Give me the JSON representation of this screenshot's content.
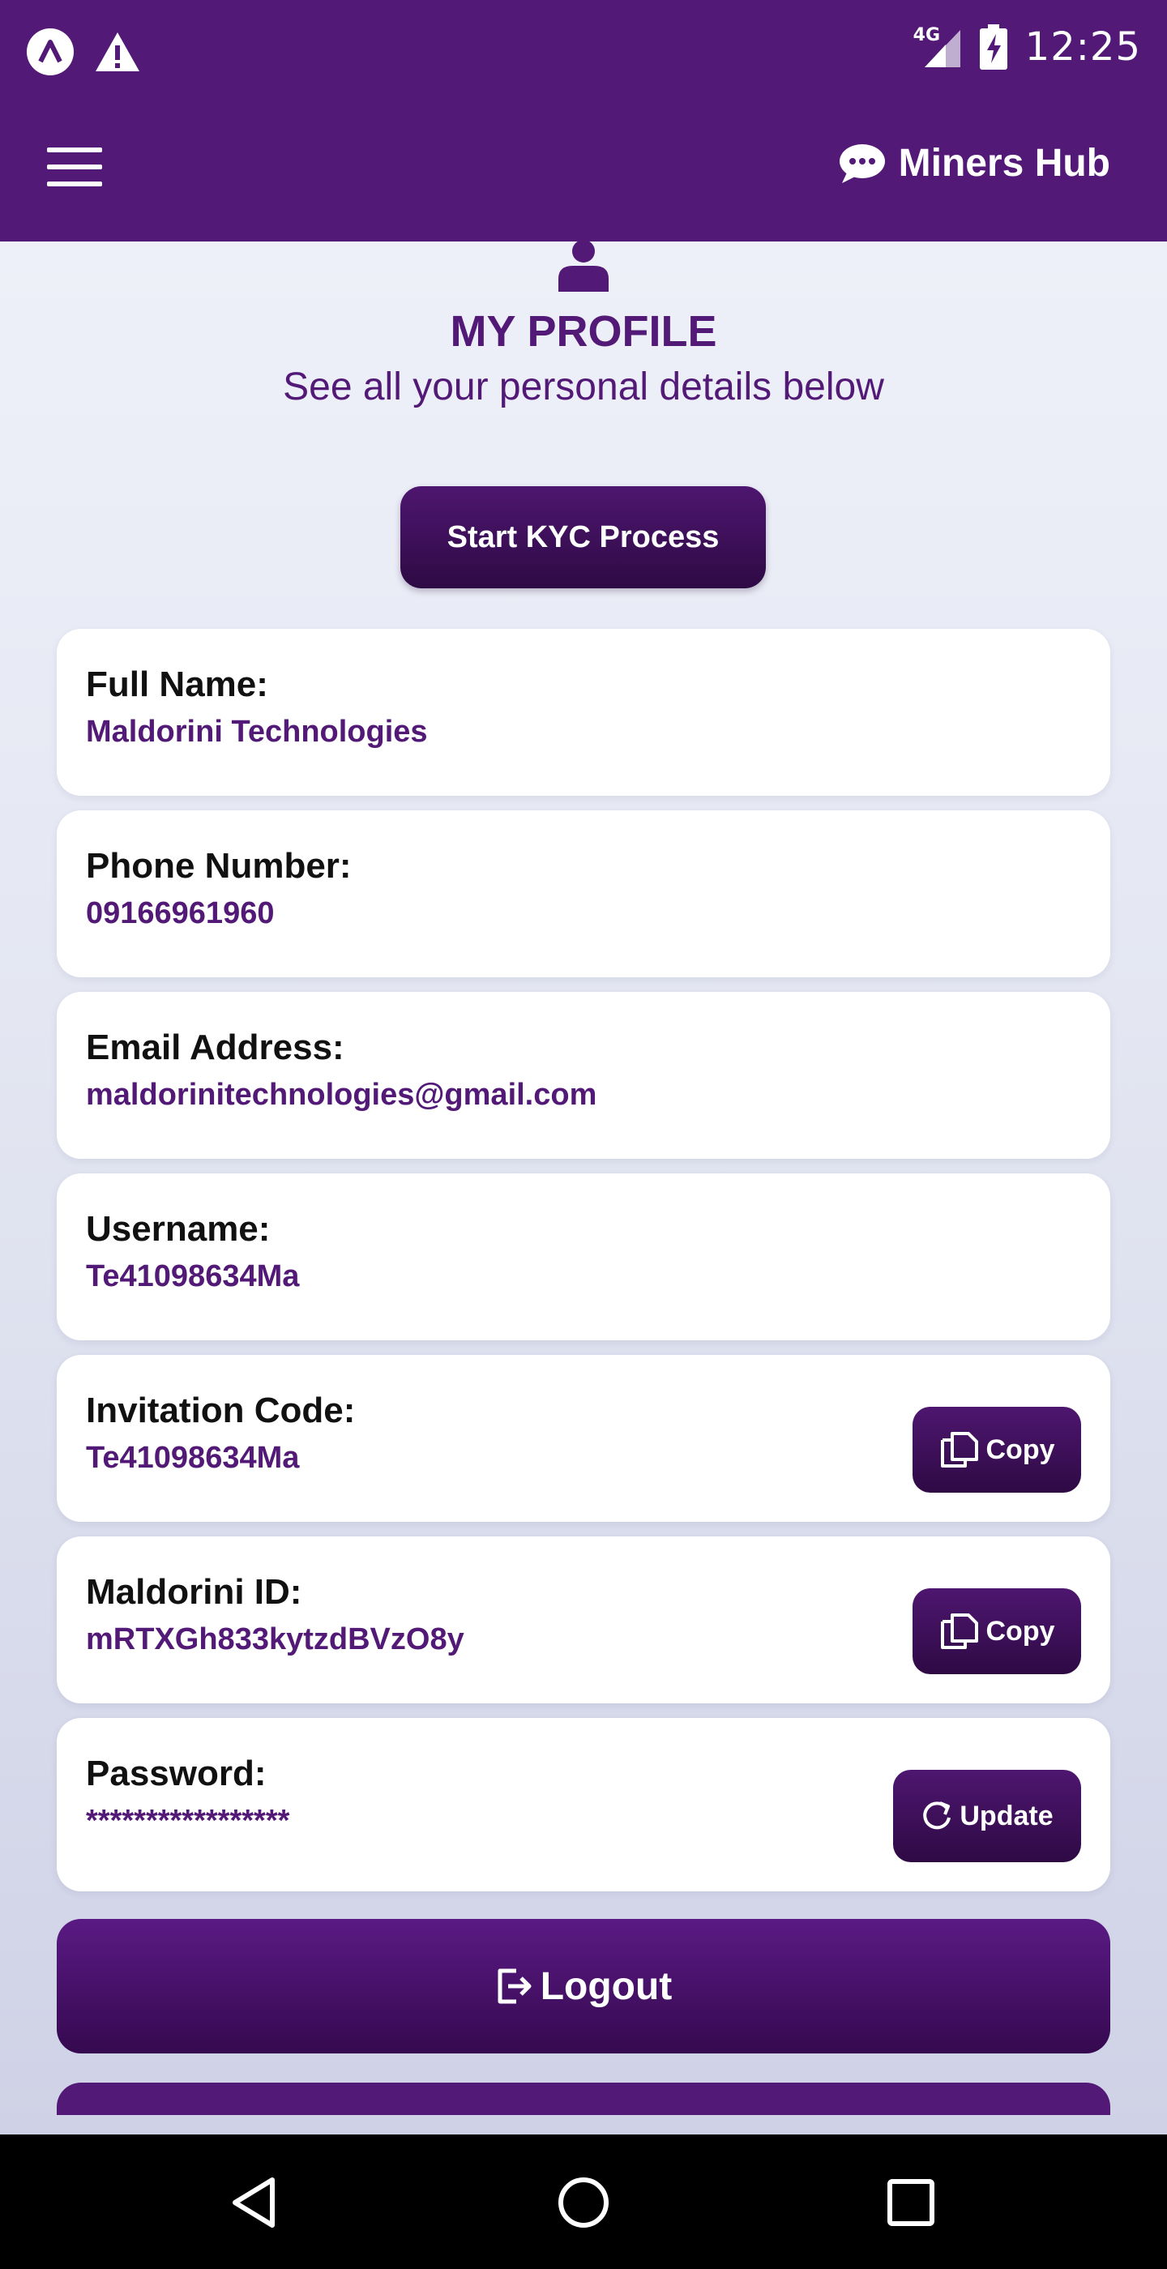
{
  "status_bar": {
    "time": "12:25",
    "network": "4G",
    "icons": [
      "app-logo-icon",
      "warning-icon",
      "signal-icon",
      "battery-charging-icon"
    ]
  },
  "app_bar": {
    "menu_icon": "hamburger-menu-icon",
    "brand_icon": "chat-bubble-icon",
    "brand_title": "Miners Hub"
  },
  "profile": {
    "icon": "user-icon",
    "title": "MY PROFILE",
    "subtitle": "See all your personal details below",
    "kyc_button": "Start KYC Process"
  },
  "fields": [
    {
      "label": "Full Name:",
      "value": "Maldorini Technologies"
    },
    {
      "label": "Phone Number:",
      "value": "09166961960"
    },
    {
      "label": "Email Address:",
      "value": "maldorinitechnologies@gmail.com"
    },
    {
      "label": "Username:",
      "value": "Te41098634Ma"
    },
    {
      "label": "Invitation Code:",
      "value": "Te41098634Ma",
      "action": "Copy",
      "action_icon": "copy-icon"
    },
    {
      "label": "Maldorini ID:",
      "value": "mRTXGh833kytzdBVzO8y",
      "action": "Copy",
      "action_icon": "copy-icon"
    },
    {
      "label": "Password:",
      "value": "*****************",
      "action": "Update",
      "action_icon": "refresh-icon"
    }
  ],
  "logout": {
    "label": "Logout",
    "icon": "logout-icon"
  },
  "nav_bar": {
    "icons": [
      "back-icon",
      "home-icon",
      "recents-icon"
    ]
  },
  "colors": {
    "primary": "#521977",
    "button_dark": "#2e0a44",
    "card_bg": "#ffffff",
    "nav_bg": "#000000"
  }
}
